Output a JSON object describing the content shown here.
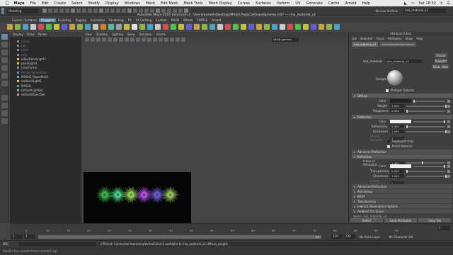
{
  "mac_menubar": {
    "app": "Maya",
    "items": [
      "File",
      "Edit",
      "Create",
      "Select",
      "Modify",
      "Display",
      "Windows",
      "Mesh",
      "Edit Mesh",
      "Mesh Tools",
      "Mesh Display",
      "Curves",
      "Surfaces",
      "Deform",
      "UV",
      "Generate",
      "Cache",
      "Arnold",
      "Help"
    ],
    "clock": "Sat 18:32"
  },
  "status_line": {
    "mode": "Modeling",
    "no_live_surface": "No Live Surface",
    "node_field": "mia_material_x1"
  },
  "window_title": "Autodesk Maya 2016 Extension 2: /Users/anselm/Desktop/MASH Projects/GrassSpheres.mb*  ---  mia_material_x1",
  "shelf_tabs": [
    "Curves / Surfaces",
    "Polygons",
    "Sculpting",
    "Rigging",
    "Animation",
    "Rendering",
    "FX",
    "FX Caching",
    "Custom",
    "MASH",
    "Bifrost",
    "TURTLE",
    "Arnold"
  ],
  "shelf_active_index": 1,
  "shelf_icon_colors": [
    "#c8a24a",
    "#8fb34a",
    "#4aa0c8",
    "#c8c8c8",
    "#d05050",
    "#50c050",
    "#c0c040",
    "#6060d0",
    "#c8a24a",
    "#8fb34a",
    "#4aa0c8",
    "#c8c8c8",
    "#d08030",
    "#50c0a0",
    "#a0a0a0",
    "#c0c040",
    "#e0e0e0",
    "#8fb34a",
    "#4aa0c8",
    "#c8c8c8",
    "#d05050",
    "#50c050",
    "#c0c040",
    "#6060d0",
    "#c8a24a",
    "#8fb34a",
    "#4aa0c8",
    "#c8c8c8",
    "#d05050",
    "#50c050",
    "#c0c040",
    "#6060d0",
    "#c8a24a",
    "#8fb34a",
    "#4aa0c8",
    "#c8c8c8",
    "#d05050",
    "#50c050",
    "#c0c040",
    "#6060d0",
    "#c8a24a",
    "#8fb34a",
    "#4aa0c8"
  ],
  "outliner": {
    "menu": [
      "Display",
      "Show",
      "Panels"
    ],
    "items": [
      "persp",
      "top",
      "front",
      "side",
      "aiSkyDomeLight1",
      "pointLight1",
      "transform1",
      "RenderSphereGeo",
      "MASH1_ReproMesh",
      "ambientLight1",
      "MASH1",
      "defaultLightSet",
      "defaultObjectSet"
    ]
  },
  "viewport": {
    "menu": [
      "View",
      "Shading",
      "Lighting",
      "Show",
      "Renderer",
      "Panels"
    ],
    "colorspace": "sRGB gamma",
    "render_info_line1": "size: 960 x 540  zoom: 0.479          (mental ray)",
    "render_info_line2": "Frame: 1        Render Time: 0:07        Camera: persp",
    "sphere_colors": [
      "#3fbf4f",
      "#4fdc8f",
      "#9ce05a",
      "#c050f0",
      "#7060e0",
      "#a0d060"
    ]
  },
  "attribute_editor": {
    "title": "Attribute Editor",
    "menu": [
      "List",
      "Selected",
      "Focus",
      "Attributes",
      "Show",
      "Help"
    ],
    "tabs": [
      "mia_material_x1",
      "mentalrayVertexColors1"
    ],
    "node_label": "mia_material:",
    "node_value": "mia_material_x1",
    "focus_btn": "Focus",
    "presets_btn": "Presets*",
    "show_btn": "Show",
    "hide_btn": "Hide",
    "sample_label": "Sample",
    "multiple_outputs": "Multiple Outputs",
    "diffuse_header": "Diffuse",
    "color_label": "Color",
    "weight_label": "Weight",
    "weight_value": "1.000",
    "weight_level": 1.0,
    "roughness_label": "Roughness",
    "roughness_value": "0.000",
    "roughness_level": 0.0,
    "reflection_header": "Reflection",
    "refl_color_label": "Color",
    "reflectivity_label": "Reflectivity",
    "reflectivity_value": "0.000",
    "reflectivity_level": 0.0,
    "glossiness_label": "Glossiness",
    "glossiness_value": "1.000",
    "glossiness_level": 1.0,
    "glossy_samples_label": "Glossy Samples",
    "glossy_samples_value": "8",
    "highlights_only": "Highlights Only",
    "metal_material": "Metal Material",
    "adv_reflection": "Advanced Reflection",
    "refraction_header": "Refraction",
    "ior_label": "Index of Refraction",
    "ior_value": "1.400",
    "ior_level": 0.4,
    "refr_color_label": "Color",
    "transparency_label": "Transparency",
    "transparency_value": "0.000",
    "transparency_level": 0.0,
    "refr_glossiness_label": "Glossiness",
    "refr_glossiness_value": "1.000",
    "refr_glossiness_level": 1.0,
    "refr_glossy_samples_label": "Glossy Samples",
    "refr_glossy_samples_value": "8",
    "collapsed_sections": [
      "Advanced Refraction",
      "Anisotropy",
      "BRDF",
      "Translucency",
      "Indirect Illumination Options",
      "Ambient Occlusion"
    ],
    "notes_label": "Notes: mia_material_x1",
    "select_btn": "Select",
    "load_attrs_btn": "Load Attributes",
    "copy_tab_btn": "Copy Tab"
  },
  "timeline": {
    "ticks": [
      "5",
      "10",
      "15",
      "20",
      "25",
      "30",
      "35",
      "40",
      "45",
      "50",
      "55",
      "60",
      "65",
      "70",
      "75",
      "80",
      "85",
      "90",
      "95"
    ],
    "current_frame": "1",
    "range_start": "1",
    "range_inner_start": "1",
    "range_inner_end": "96",
    "range_end_1": "120",
    "range_end_2": "200",
    "no_anim_layer": "No Anim Layer",
    "no_character_set": "No Character Set"
  },
  "command_line": {
    "lang": "MEL",
    "result": "// Result: Connected mentalrayVertexColors1.outAlpha to mia_material_x1.diffuse_weight."
  },
  "help_line": {
    "text": "Render the current frame (mental ray)"
  }
}
